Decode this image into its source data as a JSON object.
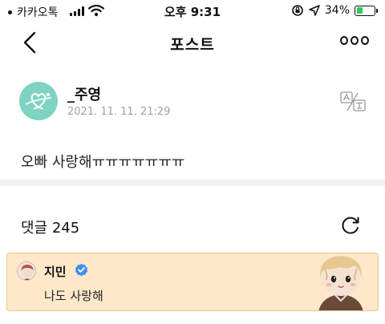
{
  "status_bar": {
    "carrier": "카카오톡",
    "time": "오후 9:31",
    "battery": "34%",
    "battery_level": 0.34,
    "icons": [
      "signal-icon",
      "wifi-icon",
      "orientation-lock-icon",
      "location-icon",
      "battery-icon"
    ]
  },
  "nav": {
    "title": "포스트",
    "back_icon": "chevron-left-icon",
    "more_icon": "more-icon"
  },
  "post": {
    "author": "_주영",
    "date": "2021. 11. 11. 21:29",
    "content": "오빠 사랑해ㅠㅠㅠㅠㅠㅠㅠ",
    "translate_icon": "translate-icon"
  },
  "comments": {
    "header": "댓글 245",
    "refresh_icon": "refresh-icon",
    "items": [
      {
        "name": "지민",
        "verified": true,
        "text": "나도 사랑해",
        "highlight_color": "#fde9c9"
      }
    ]
  },
  "colors": {
    "accent_verify": "#3d8ef5",
    "avatar_bg": "#7fd3c2",
    "battery_fill": "#35c759"
  }
}
